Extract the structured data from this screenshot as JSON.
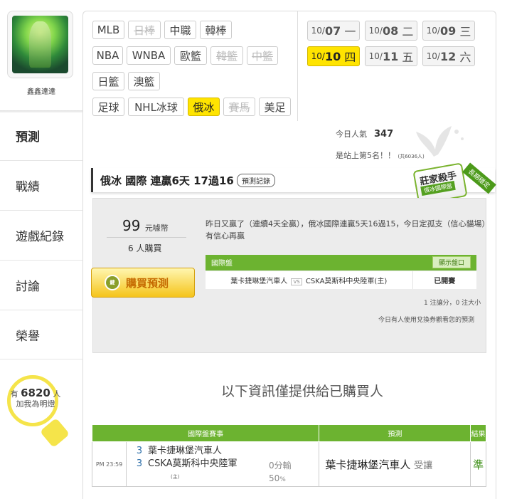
{
  "sidebar": {
    "username": "鑫鑫達達",
    "nav": [
      "預測",
      "戰績",
      "遊戲紀錄",
      "討論",
      "榮譽"
    ],
    "bulb": {
      "prefix": "有",
      "count": "6820",
      "suffix": "人",
      "label": "加我為明燈"
    }
  },
  "tabs": [
    {
      "label": "MLB",
      "state": "normal"
    },
    {
      "label": "日棒",
      "state": "disabled"
    },
    {
      "label": "中職",
      "state": "normal"
    },
    {
      "label": "韓棒",
      "state": "normal"
    },
    {
      "label": "NBA",
      "state": "normal"
    },
    {
      "label": "WNBA",
      "state": "normal"
    },
    {
      "label": "歐籃",
      "state": "normal"
    },
    {
      "label": "韓籃",
      "state": "disabled"
    },
    {
      "label": "中籃",
      "state": "disabled"
    },
    {
      "label": "日籃",
      "state": "normal"
    },
    {
      "label": "澳籃",
      "state": "normal"
    },
    {
      "label": "足球",
      "state": "normal"
    },
    {
      "label": "NHL冰球",
      "state": "normal"
    },
    {
      "label": "俄冰",
      "state": "selected"
    },
    {
      "label": "賽馬",
      "state": "disabled"
    },
    {
      "label": "美足",
      "state": "normal"
    }
  ],
  "dates": [
    {
      "md": "10/",
      "day": "07",
      "wd": "一",
      "selected": false
    },
    {
      "md": "10/",
      "day": "08",
      "wd": "二",
      "selected": false
    },
    {
      "md": "10/",
      "day": "09",
      "wd": "三",
      "selected": false
    },
    {
      "md": "10/",
      "day": "10",
      "wd": "四",
      "selected": true
    },
    {
      "md": "10/",
      "day": "11",
      "wd": "五",
      "selected": false
    },
    {
      "md": "10/",
      "day": "12",
      "wd": "六",
      "selected": false
    }
  ],
  "stats": {
    "popularity_label": "今日人氣",
    "popularity_value": "347",
    "rank_text": "是站上第5名！！",
    "rank_total": "(共6036人)"
  },
  "panel": {
    "title": "俄冰 國際 連贏6天 17過16",
    "record_button": "預測記錄",
    "badge_main": "莊家殺手",
    "badge_sub": "俄冰國際盤",
    "badge_ribbon": "長期穩定",
    "price": "99",
    "price_unit": "元噱幣",
    "buyers": "6 人購買",
    "buy_button": "購買預測",
    "buy_icon": "鍵",
    "comment": "昨日又贏了（連續4天全贏），俄冰國際連贏5天16過15，今日定孤支（信心貓場）有信心再贏",
    "table_header": "國際盤",
    "show_button": "顯示盤口",
    "home": "葉卡捷琳堡汽車人",
    "vs": "VS",
    "away": "CSKA莫斯科中央陸軍(主)",
    "status": "已開賽",
    "note1": "1 注讓分，0 注大小",
    "note2": "今日有人使用兌換券觀看您的預測"
  },
  "info_title": "以下資訊僅提供給已購買人",
  "results_table": {
    "headers": [
      "國際盤賽事",
      "預測",
      "結果"
    ],
    "row": {
      "time": "PM 23:59",
      "team1_score": "3",
      "team1": "葉卡捷琳堡汽車人",
      "team2_score": "3",
      "team2": "CSKA莫斯科中央陸軍",
      "host": "(主)",
      "odds_line": "0分輸",
      "odds_pct": "50",
      "odds_pct_unit": "%",
      "pick": "葉卡捷琳堡汽車人",
      "pick_note": "受讓",
      "result": "準"
    }
  }
}
